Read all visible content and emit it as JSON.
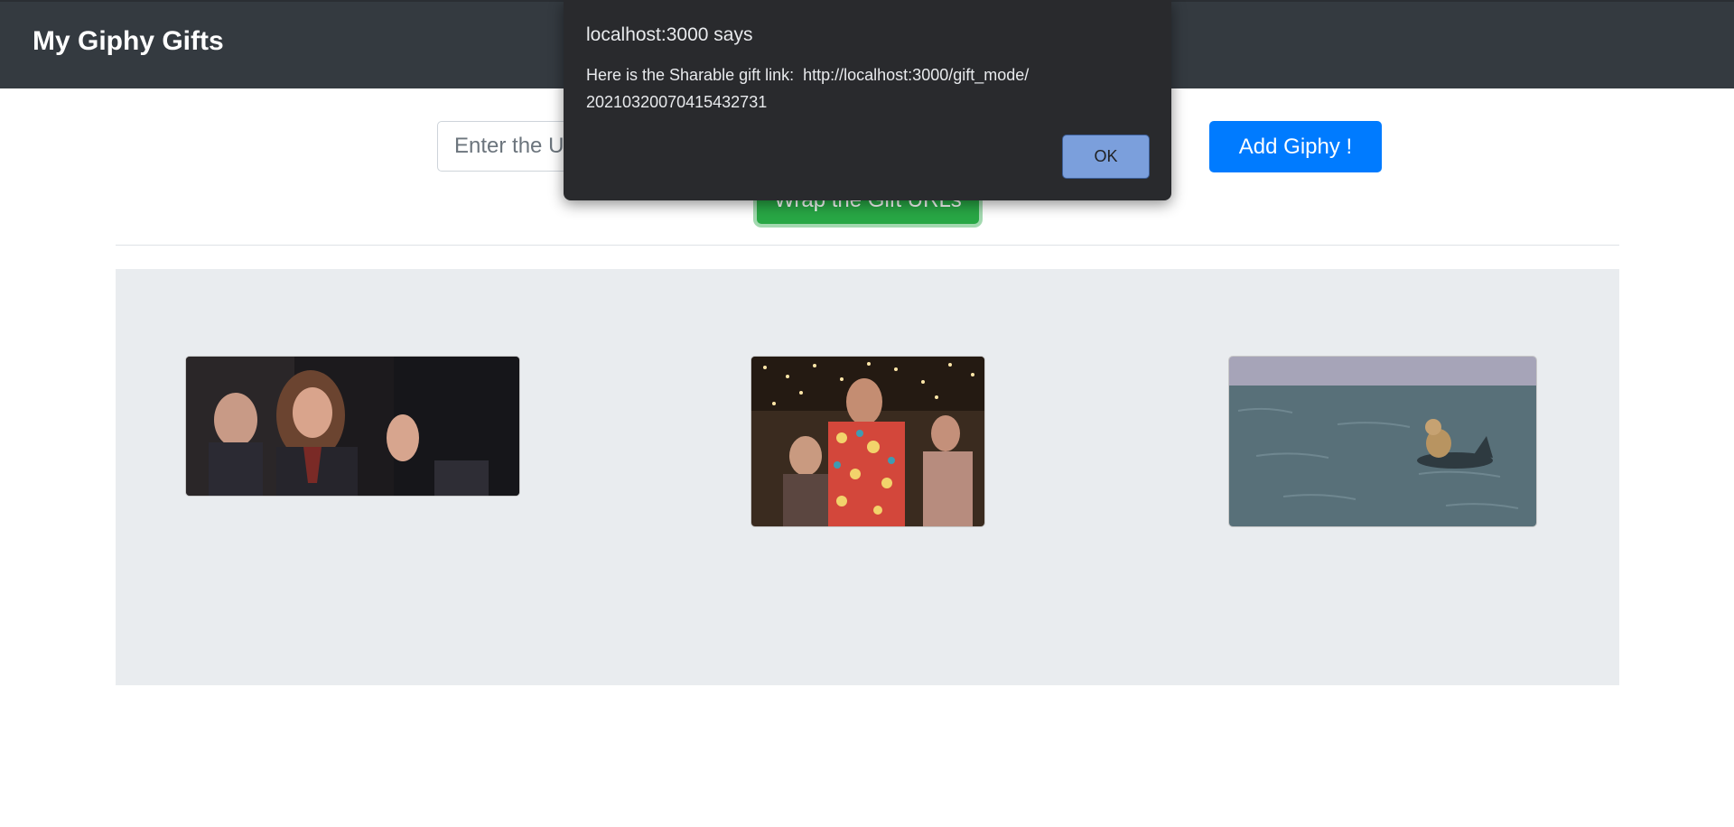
{
  "navbar": {
    "brand": "My Giphy Gifts"
  },
  "form": {
    "url_input_placeholder": "Enter the URL",
    "add_button_label": "Add Giphy !",
    "wrap_button_label": "Wrap the Gift URLs"
  },
  "gallery": {
    "items": [
      {
        "icon": "gif-image"
      },
      {
        "icon": "gif-image"
      },
      {
        "icon": "gif-image"
      }
    ]
  },
  "dialog": {
    "title": "localhost:3000 says",
    "message_line1": "Here is the Sharable gift link:  http://localhost:3000/gift_mode/",
    "message_line2": "20210320070415432731",
    "ok_label": "OK"
  },
  "colors": {
    "navbar": "#343a40",
    "primary": "#007bff",
    "success": "#28a745",
    "gallery_bg": "#e9ecef",
    "dialog_bg": "#292a2d"
  }
}
